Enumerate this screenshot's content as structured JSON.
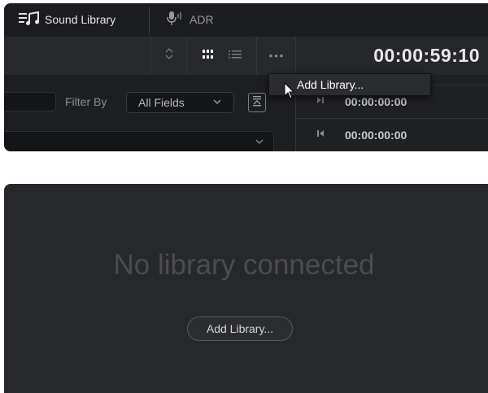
{
  "tabs": {
    "sound_library": "Sound Library",
    "adr": "ADR"
  },
  "toolbar": {
    "more_label": "•••"
  },
  "timecode": {
    "main": "00:00:59:10",
    "row1": "00:00:00:00",
    "row2": "00:00:00:00"
  },
  "filter": {
    "label": "Filter By",
    "selected": "All Fields"
  },
  "context_menu": {
    "item": "Add Library..."
  },
  "empty_state": {
    "title": "No library connected",
    "button_label": "Add Library..."
  },
  "icons": {
    "tab_sound": "sound-library-icon",
    "tab_adr": "microphone-icon",
    "sort": "sort-icon",
    "grid": "grid-view-icon",
    "list": "list-view-icon",
    "more": "more-icon",
    "collapse": "collapse-icon",
    "play_in": "play-in-icon",
    "skip_back": "skip-back-icon",
    "cursor": "cursor-icon"
  },
  "colors": {
    "panel_bg": "#1d1e21",
    "toolbar_bg": "#28292d",
    "empty_panel_bg": "#27282c",
    "text_light": "#e6e6e6",
    "text_dim": "#4b4c51"
  }
}
